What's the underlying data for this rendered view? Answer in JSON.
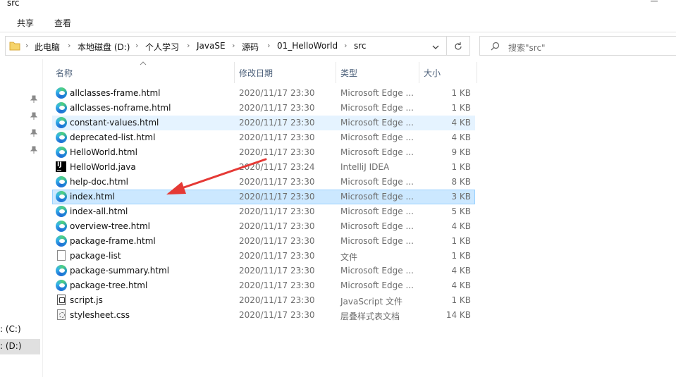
{
  "window": {
    "title": "src"
  },
  "ribbon": {
    "tabs": [
      "共享",
      "查看"
    ]
  },
  "address": {
    "crumbs": [
      "此电脑",
      "本地磁盘 (D:)",
      "个人学习",
      "JavaSE",
      "源码",
      "01_HelloWorld",
      "src"
    ]
  },
  "search": {
    "placeholder": "搜索\"src\""
  },
  "nav": {
    "drives": [
      {
        "label": ": (C:)"
      },
      {
        "label": ": (D:)"
      }
    ]
  },
  "columns": {
    "name": "名称",
    "date": "修改日期",
    "type": "类型",
    "size": "大小"
  },
  "files": [
    {
      "name": "allclasses-frame.html",
      "date": "2020/11/17 23:30",
      "type": "Microsoft Edge ...",
      "size": "1 KB",
      "icon": "edge"
    },
    {
      "name": "allclasses-noframe.html",
      "date": "2020/11/17 23:30",
      "type": "Microsoft Edge ...",
      "size": "1 KB",
      "icon": "edge"
    },
    {
      "name": "constant-values.html",
      "date": "2020/11/17 23:30",
      "type": "Microsoft Edge ...",
      "size": "4 KB",
      "icon": "edge"
    },
    {
      "name": "deprecated-list.html",
      "date": "2020/11/17 23:30",
      "type": "Microsoft Edge ...",
      "size": "4 KB",
      "icon": "edge"
    },
    {
      "name": "HelloWorld.html",
      "date": "2020/11/17 23:30",
      "type": "Microsoft Edge ...",
      "size": "9 KB",
      "icon": "edge"
    },
    {
      "name": "HelloWorld.java",
      "date": "2020/11/17 23:24",
      "type": "IntelliJ IDEA",
      "size": "1 KB",
      "icon": "intellij"
    },
    {
      "name": "help-doc.html",
      "date": "2020/11/17 23:30",
      "type": "Microsoft Edge ...",
      "size": "8 KB",
      "icon": "edge"
    },
    {
      "name": "index.html",
      "date": "2020/11/17 23:30",
      "type": "Microsoft Edge ...",
      "size": "3 KB",
      "icon": "edge"
    },
    {
      "name": "index-all.html",
      "date": "2020/11/17 23:30",
      "type": "Microsoft Edge ...",
      "size": "5 KB",
      "icon": "edge"
    },
    {
      "name": "overview-tree.html",
      "date": "2020/11/17 23:30",
      "type": "Microsoft Edge ...",
      "size": "4 KB",
      "icon": "edge"
    },
    {
      "name": "package-frame.html",
      "date": "2020/11/17 23:30",
      "type": "Microsoft Edge ...",
      "size": "1 KB",
      "icon": "edge"
    },
    {
      "name": "package-list",
      "date": "2020/11/17 23:30",
      "type": "文件",
      "size": "1 KB",
      "icon": "file"
    },
    {
      "name": "package-summary.html",
      "date": "2020/11/17 23:30",
      "type": "Microsoft Edge ...",
      "size": "4 KB",
      "icon": "edge"
    },
    {
      "name": "package-tree.html",
      "date": "2020/11/17 23:30",
      "type": "Microsoft Edge ...",
      "size": "4 KB",
      "icon": "edge"
    },
    {
      "name": "script.js",
      "date": "2020/11/17 23:30",
      "type": "JavaScript 文件",
      "size": "1 KB",
      "icon": "js"
    },
    {
      "name": "stylesheet.css",
      "date": "2020/11/17 23:30",
      "type": "层叠样式表文档",
      "size": "14 KB",
      "icon": "css"
    }
  ],
  "selection": {
    "selected": "index.html",
    "hovered": "constant-values.html"
  },
  "colors": {
    "selected_bg": "#cce8ff",
    "hover_bg": "#e5f3ff",
    "arrow": "#e53935"
  }
}
